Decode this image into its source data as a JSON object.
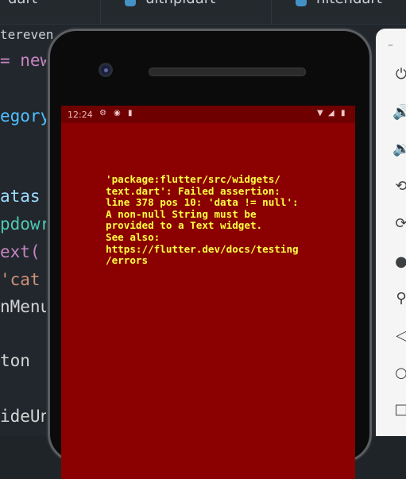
{
  "editor": {
    "tabs": [
      {
        "label": "dart"
      },
      {
        "label": "ulthpidart"
      },
      {
        "label": "hitendart"
      }
    ],
    "code_lines": [
      {
        "text": "tereven",
        "color": "#c9d1d9"
      },
      {
        "text": "= new",
        "color": "#c586c0"
      },
      {
        "text": "egory",
        "color": "#4fc1ff"
      },
      {
        "text": "atas",
        "color": "#9cdcfe"
      },
      {
        "text": "pdowr",
        "color": "#4ec9b0"
      },
      {
        "text": "ext(",
        "color": "#c586c0"
      },
      {
        "text": "'cat",
        "color": "#ce9178"
      },
      {
        "text": "nMenu",
        "color": "#d4d4d4"
      },
      {
        "text": "ton",
        "color": "#d4d4d4"
      },
      {
        "text": "ideUn",
        "color": "#d4d4d4"
      }
    ]
  },
  "emulator": {
    "status_time": "12:24",
    "error_message": "'package:flutter/src/widgets/\ntext.dart': Failed assertion:\nline 378 pos 10: 'data != null':\nA non-null String must be\nprovided to a Text widget.\nSee also:\nhttps://flutter.dev/docs/testing\n/errors",
    "screen_color": "#8b0000",
    "error_text_color": "#ffff44"
  },
  "emulator_controls": {
    "minimize_label": "–",
    "icons": [
      "power-icon",
      "volume-up-icon",
      "volume-down-icon",
      "rotate-left-icon",
      "rotate-right-icon",
      "camera-icon",
      "zoom-icon",
      "back-icon",
      "home-icon",
      "overview-icon"
    ]
  }
}
